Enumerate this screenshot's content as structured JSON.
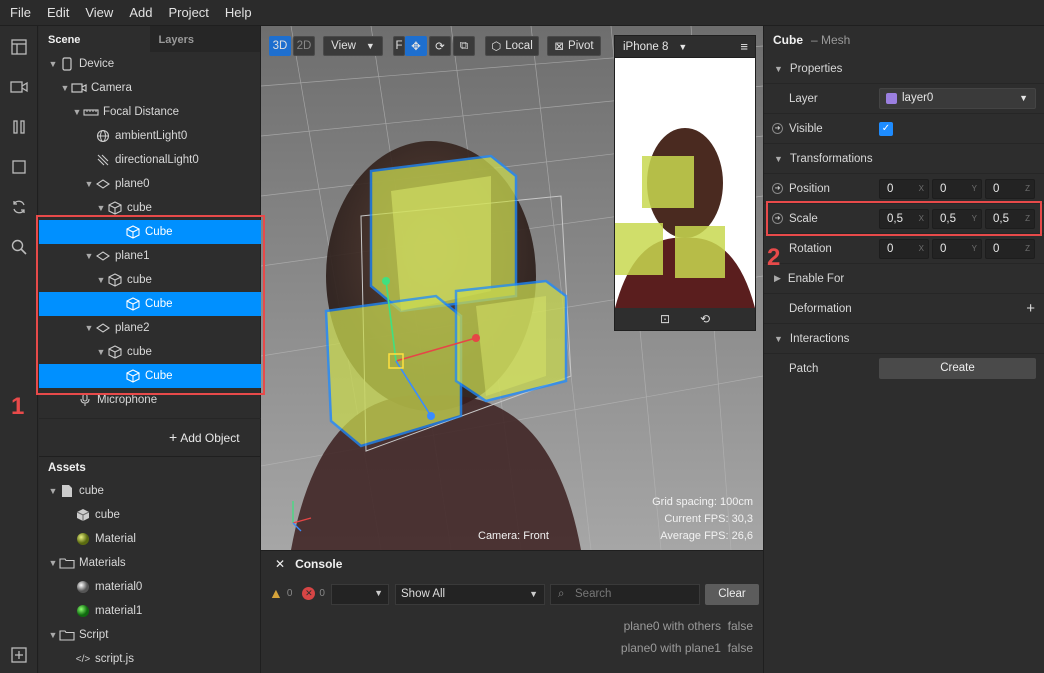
{
  "menu": [
    "File",
    "Edit",
    "View",
    "Add",
    "Project",
    "Help"
  ],
  "scene": {
    "tabs": {
      "scene": "Scene",
      "layers": "Layers"
    },
    "items": [
      {
        "label": "Device",
        "level": 0
      },
      {
        "label": "Camera",
        "level": 1
      },
      {
        "label": "Focal Distance",
        "level": 2
      },
      {
        "label": "ambientLight0",
        "level": 3
      },
      {
        "label": "directionalLight0",
        "level": 3
      },
      {
        "label": "plane0",
        "level": 3
      },
      {
        "label": "cube",
        "level": 4
      },
      {
        "label": "Cube",
        "level": 5
      },
      {
        "label": "plane1",
        "level": 3
      },
      {
        "label": "cube",
        "level": 4
      },
      {
        "label": "Cube",
        "level": 5
      },
      {
        "label": "plane2",
        "level": 3
      },
      {
        "label": "cube",
        "level": 4
      },
      {
        "label": "Cube",
        "level": 5
      },
      {
        "label": "Microphone",
        "level": 1
      }
    ],
    "add_object": "Add Object"
  },
  "assets": {
    "title": "Assets",
    "items": [
      {
        "label": "cube"
      },
      {
        "label": "cube"
      },
      {
        "label": "Material"
      },
      {
        "label": "Materials"
      },
      {
        "label": "material0"
      },
      {
        "label": "material1"
      },
      {
        "label": "Script"
      },
      {
        "label": "script.js"
      }
    ]
  },
  "viewport": {
    "mode_3d": "3D",
    "mode_2d": "2D",
    "view": "View",
    "local": "Local",
    "pivot": "Pivot",
    "f": "F",
    "camera_label": "Camera: Front",
    "stats": {
      "grid": "Grid spacing: 100cm",
      "fps": "Current FPS: 30,3",
      "avg": "Average FPS: 26,6"
    },
    "device": "iPhone 8"
  },
  "console": {
    "title": "Console",
    "warn_count": "0",
    "err_count": "0",
    "filter": "Show All",
    "search_placeholder": "Search",
    "clear": "Clear",
    "lines": [
      {
        "text": "plane0 with others",
        "value": "false"
      },
      {
        "text": "plane0 with plane1",
        "value": "false"
      }
    ]
  },
  "properties": {
    "object": "Cube",
    "type": "– Mesh",
    "sections": {
      "properties": "Properties",
      "transformations": "Transformations",
      "enable_for": "Enable For",
      "deformation": "Deformation",
      "interactions": "Interactions"
    },
    "layer_label": "Layer",
    "layer_value": "layer0",
    "visible_label": "Visible",
    "position_label": "Position",
    "position": [
      "0",
      "0",
      "0"
    ],
    "scale_label": "Scale",
    "scale": [
      "0,5",
      "0,5",
      "0,5"
    ],
    "rotation_label": "Rotation",
    "rotation": [
      "0",
      "0",
      "0"
    ],
    "patch_label": "Patch",
    "create": "Create",
    "axes": [
      "X",
      "Y",
      "Z"
    ]
  },
  "annotations": {
    "one": "1",
    "two": "2"
  },
  "colors": {
    "selection": "#0090ff",
    "annotation": "#e84a4a",
    "layer_swatch": "#9b7fe0",
    "checkbox": "#1e8cff"
  }
}
